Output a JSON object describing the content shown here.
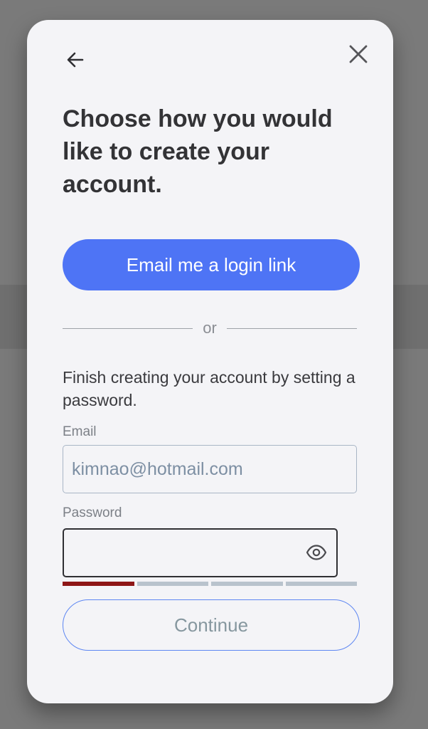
{
  "dialog": {
    "title": "Choose how you would like to create your account.",
    "email_link_button": "Email me a login link",
    "divider_text": "or",
    "description": "Finish creating your account by setting a password.",
    "email": {
      "label": "Email",
      "placeholder": "kimnao@hotmail.com",
      "value": ""
    },
    "password": {
      "label": "Password",
      "value": "",
      "strength_level": 1,
      "strength_segments": 4
    },
    "continue_button": "Continue"
  },
  "icons": {
    "back": "arrow-left-icon",
    "close": "close-icon",
    "visibility": "eye-icon"
  },
  "colors": {
    "primary": "#4e74f5",
    "strength_weak": "#8e1616",
    "strength_empty": "#b9c3cd"
  }
}
